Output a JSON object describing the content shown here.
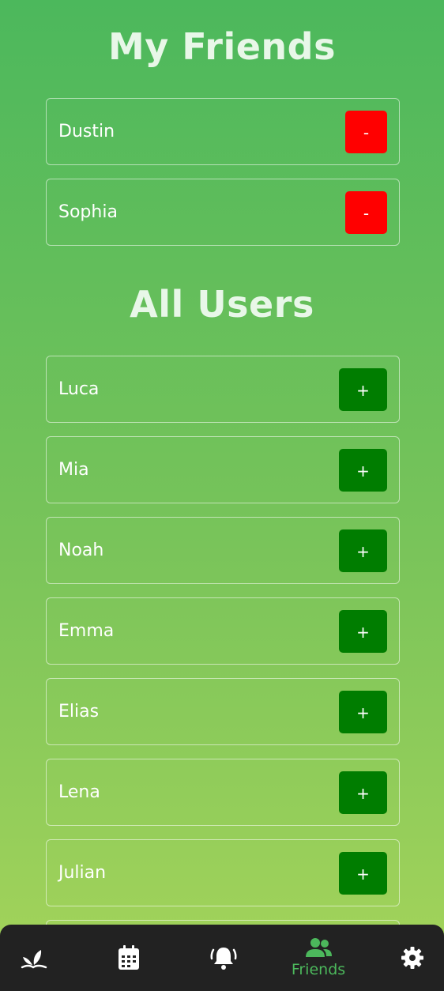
{
  "friends_section": {
    "title": "My Friends",
    "remove_label": "-",
    "friends": [
      {
        "name": "Dustin"
      },
      {
        "name": "Sophia"
      }
    ]
  },
  "users_section": {
    "title": "All Users",
    "add_label": "+",
    "users": [
      {
        "name": "Luca"
      },
      {
        "name": "Mia"
      },
      {
        "name": "Noah"
      },
      {
        "name": "Emma"
      },
      {
        "name": "Elias"
      },
      {
        "name": "Lena"
      },
      {
        "name": "Julian"
      }
    ]
  },
  "bottom_nav": {
    "items": [
      {
        "icon": "plant-icon",
        "label": ""
      },
      {
        "icon": "calendar-icon",
        "label": ""
      },
      {
        "icon": "bell-ringing-icon",
        "label": ""
      },
      {
        "icon": "users-icon",
        "label": "Friends",
        "active": true
      },
      {
        "icon": "gear-icon",
        "label": ""
      }
    ]
  },
  "colors": {
    "remove_button": "#ff0000",
    "add_button": "#007d00",
    "nav_background": "#222222",
    "accent": "#4cb85c"
  }
}
